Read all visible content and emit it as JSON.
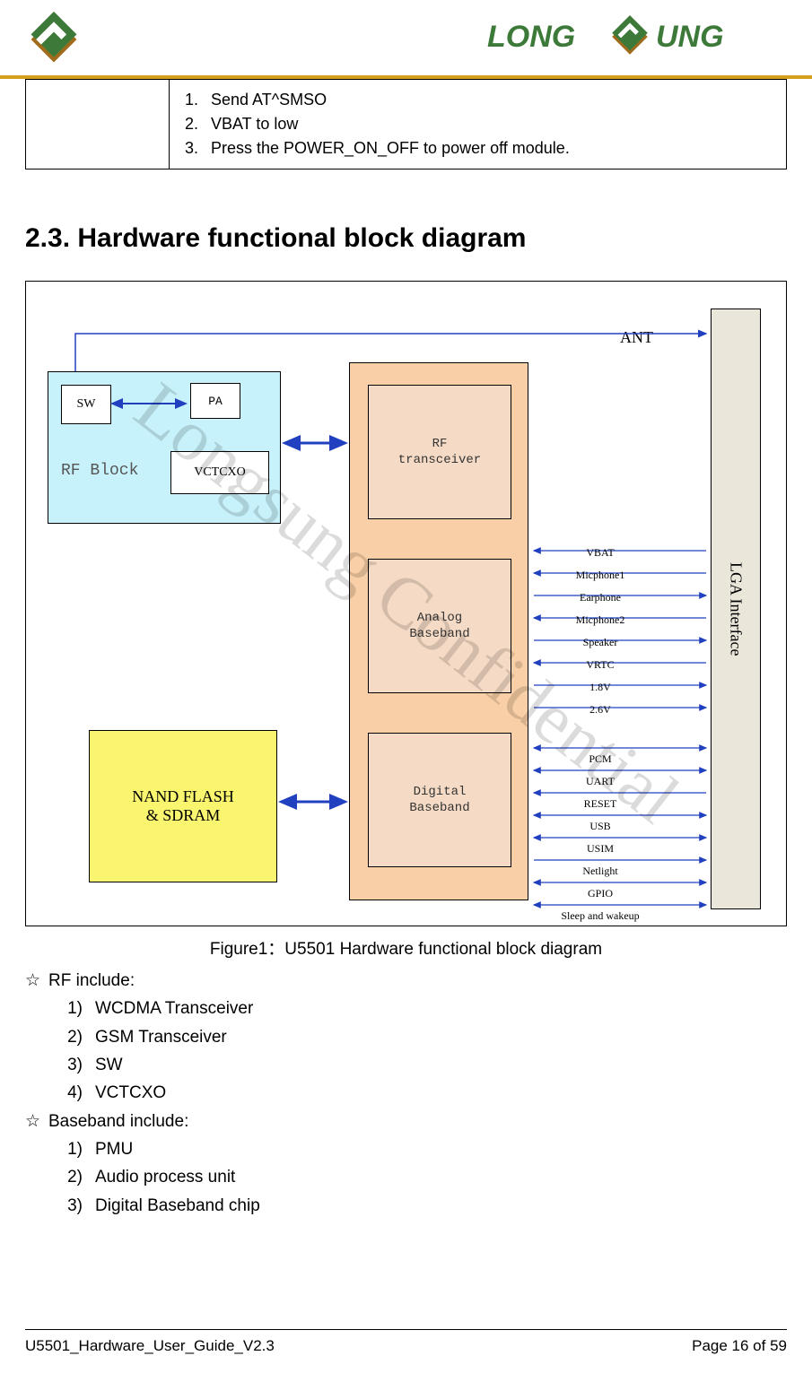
{
  "header": {
    "brand": "LONG SUNG"
  },
  "top_table": {
    "items": [
      {
        "num": "1.",
        "text": "Send AT^SMSO"
      },
      {
        "num": "2.",
        "text": "VBAT to low"
      },
      {
        "num": "3.",
        "text": "Press the POWER_ON_OFF to power off module."
      }
    ]
  },
  "section_title": "2.3. Hardware functional block diagram",
  "watermark": "Longsung Confidential",
  "diagram": {
    "ant": "ANT",
    "lga": "LGA Interface",
    "rf_block": {
      "label": "RF Block",
      "sw": "SW",
      "pa": "PA",
      "vctcxo": "VCTCXO"
    },
    "baseband": {
      "rf_transceiver_l1": "RF",
      "rf_transceiver_l2": "transceiver",
      "analog_l1": "Analog",
      "analog_l2": "Baseband",
      "digital_l1": "Digital",
      "digital_l2": "Baseband"
    },
    "flash_l1": "NAND FLASH",
    "flash_l2": "& SDRAM",
    "signals_analog": [
      "VBAT",
      "Micphone1",
      "Earphone",
      "Micphone2",
      "Speaker",
      "VRTC",
      "1.8V",
      "2.6V"
    ],
    "signals_digital": [
      "PCM",
      "UART",
      "RESET",
      "USB",
      "USIM",
      "Netlight",
      "GPIO",
      "Sleep and wakeup"
    ]
  },
  "caption": "Figure1：U5501 Hardware functional block diagram",
  "body": {
    "rf_include_label": "RF include:",
    "rf_include": [
      {
        "n": "1)",
        "t": "WCDMA Transceiver"
      },
      {
        "n": "2)",
        "t": "GSM Transceiver"
      },
      {
        "n": "3)",
        "t": "SW"
      },
      {
        "n": "4)",
        "t": "VCTCXO"
      }
    ],
    "bb_include_label": "Baseband include:",
    "bb_include": [
      {
        "n": "1)",
        "t": "PMU"
      },
      {
        "n": "2)",
        "t": "Audio process unit"
      },
      {
        "n": "3)",
        "t": "Digital Baseband chip"
      }
    ]
  },
  "footer": {
    "left": "U5501_Hardware_User_Guide_V2.3",
    "right": "Page 16 of 59"
  }
}
